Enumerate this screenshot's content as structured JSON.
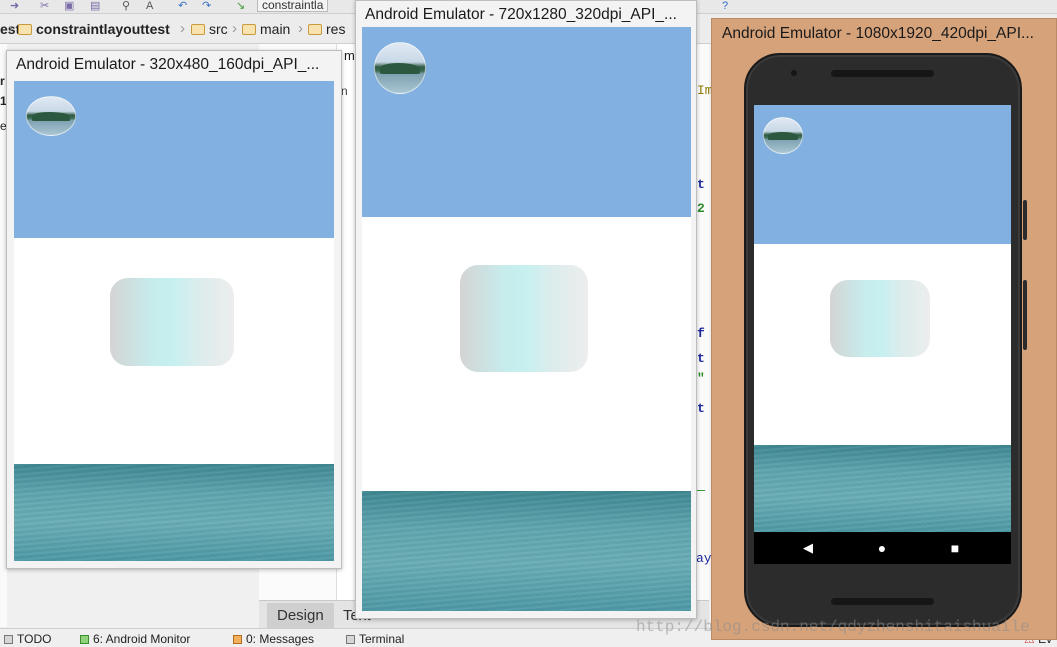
{
  "ide": {
    "toolbar_tab": "constraintla",
    "breadcrumbs": [
      {
        "label": "constraintlayouttest",
        "bold": true
      },
      {
        "label": "src",
        "bold": false
      },
      {
        "label": "main",
        "bold": false
      },
      {
        "label": "res",
        "bold": false
      }
    ],
    "crumb_prefix": "est",
    "left_strip": [
      "r",
      "1",
      "e"
    ],
    "editor_tab": "m",
    "code_fragments": [
      "Im",
      "t",
      "2",
      "f",
      "t",
      "\"",
      "t",
      "ay"
    ],
    "bottom_tabs": {
      "design": "Design",
      "text": "Text"
    },
    "status_bar": [
      {
        "label": "TODO",
        "icon": "todo-icon"
      },
      {
        "label": "6: Android Monitor",
        "icon": "android-icon"
      },
      {
        "label": "0: Messages",
        "icon": "messages-icon"
      },
      {
        "label": "Terminal",
        "icon": "terminal-icon"
      }
    ],
    "status_right": "Ev",
    "watermark": "http://blog.csdn.net/qdyzhenshitaishuaile"
  },
  "emulators": [
    {
      "title": "Android Emulator - 320x480_160dpi_API_..."
    },
    {
      "title": "Android Emulator - 720x1280_320dpi_API_..."
    },
    {
      "title": "Android Emulator - 1080x1920_420dpi_API..."
    }
  ],
  "phone_nav": {
    "back": "◀",
    "home": "●",
    "recent": "■"
  },
  "colors": {
    "top_band": "#82b0e0",
    "card_gradient": [
      "#d4d4d4",
      "#c6f0f0",
      "#ededed"
    ],
    "bottom_band": "#5fa5ae",
    "phone_window": "#d6a27a"
  }
}
